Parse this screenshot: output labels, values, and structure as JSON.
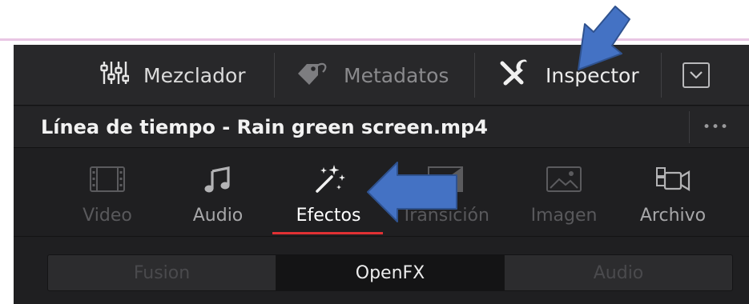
{
  "toolbar": {
    "mixer_label": "Mezclador",
    "metadata_label": "Metadatos",
    "inspector_label": "Inspector",
    "mixer_icon": "mixer-sliders-icon",
    "metadata_icon": "tag-icon",
    "inspector_icon": "tools-icon",
    "dropdown_icon": "chevron-down-icon"
  },
  "timeline": {
    "title": "Línea de tiempo - Rain green screen.mp4",
    "more_label": "•••"
  },
  "inspector_tabs": [
    {
      "label": "Video",
      "icon": "film-icon",
      "state": "dim"
    },
    {
      "label": "Audio",
      "icon": "music-note-icon",
      "state": "regular"
    },
    {
      "label": "Efectos",
      "icon": "magic-wand-icon",
      "state": "selected"
    },
    {
      "label": "Transición",
      "icon": "transition-icon",
      "state": "dim"
    },
    {
      "label": "Imagen",
      "icon": "image-icon",
      "state": "dim"
    },
    {
      "label": "Archivo",
      "icon": "camera-icon",
      "state": "regular"
    }
  ],
  "segments": [
    {
      "label": "Fusion",
      "selected": false
    },
    {
      "label": "OpenFX",
      "selected": true
    },
    {
      "label": "Audio",
      "selected": false
    }
  ],
  "annotations": [
    {
      "icon": "arrow-down-left-icon",
      "color": "#4472c4",
      "points_to": "Inspector"
    },
    {
      "icon": "arrow-left-icon",
      "color": "#4472c4",
      "points_to": "Efectos"
    }
  ],
  "colors": {
    "panel_bg": "#1f1f21",
    "toolbar_bg": "#28282a",
    "selected_underline": "#e03134",
    "annotation_blue": "#4472c4"
  }
}
